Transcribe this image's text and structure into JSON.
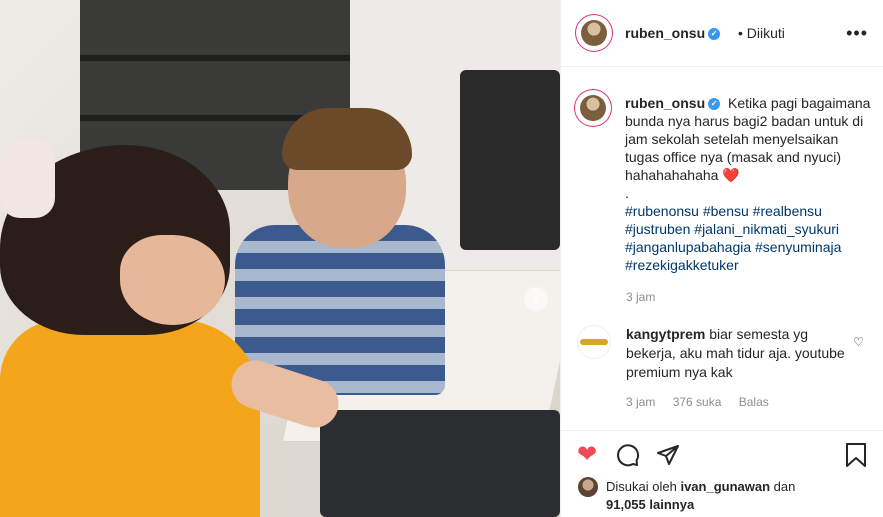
{
  "post": {
    "image_alt": "Photo post"
  },
  "header": {
    "username": "ruben_onsu",
    "follow_status": "• Diikuti",
    "more_icon": "more-horizontal-icon"
  },
  "caption": {
    "username": "ruben_onsu",
    "text": "Ketika pagi bagaimana bunda nya harus bagi2 badan untuk di jam sekolah setelah menyelsaikan tugas office nya (masak and nyuci) hahahahahaha",
    "emoji": "❤️",
    "separator": ".",
    "hashtags": [
      "#rubenonsu",
      "#bensu",
      "#realbensu",
      "#justruben",
      "#jalani_nikmati_syukuri",
      "#janganlupabahagia",
      "#senyuminaja",
      "#rezekigakketuker"
    ],
    "time": "3 jam"
  },
  "comment": {
    "username": "kangytprem",
    "text": "biar semesta yg bekerja, aku mah tidur aja. youtube premium nya kak",
    "time": "3 jam",
    "likes": "376 suka",
    "reply": "Balas"
  },
  "likes": {
    "prefix": "Disukai oleh",
    "user": "ivan_gunawan",
    "and": "dan",
    "count": "91,055 lainnya"
  },
  "colors": {
    "like_red": "#ed4956",
    "link_blue": "#00376b",
    "verified_blue": "#3897f0",
    "muted": "#8e8e8e"
  }
}
